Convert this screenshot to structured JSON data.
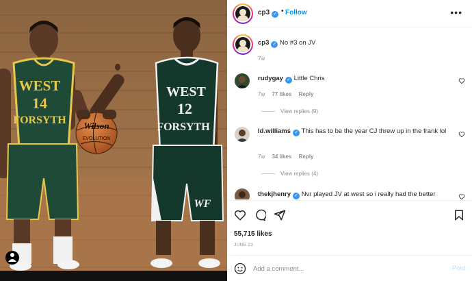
{
  "post": {
    "username": "cp3",
    "follow_label": "Follow",
    "dot": "•",
    "more_label": "•••",
    "caption": "No #3 on JV",
    "caption_age": "7w",
    "likes": "55,715 likes",
    "date": "JUNE 23",
    "comment_placeholder": "Add a comment...",
    "post_label": "Post"
  },
  "jerseys": {
    "left_team_line1": "WEST",
    "left_number": "14",
    "left_team_line2": "FORSYTH",
    "right_team_line1": "WEST",
    "right_number": "12",
    "right_team_line2": "FORSYTH",
    "shorts_logo": "WF",
    "ball_brand": "Wilson",
    "ball_model": "EVOLUTION"
  },
  "comments": [
    {
      "username": "rudygay",
      "text": "Little Chris",
      "age": "7w",
      "likes": "77 likes",
      "reply": "Reply",
      "view_replies": "View replies (9)"
    },
    {
      "username": "ld.williams",
      "text": "This has to be the year CJ threw up in the frank lol",
      "age": "7w",
      "likes": "34 likes",
      "reply": "Reply",
      "view_replies": "View replies (4)"
    },
    {
      "username": "thekjhenry",
      "text": "Nvr played JV at west so i really had the better"
    }
  ],
  "icons": [
    "heart-icon",
    "comment-icon",
    "share-icon",
    "bookmark-icon",
    "emoji-icon",
    "verified-icon",
    "more-icon"
  ],
  "colors": {
    "accent": "#0095f6",
    "verified": "#3897f0",
    "jersey_left": "#1f4a38",
    "jersey_right": "#14382c",
    "trim": "#e8c84a",
    "court": "#a8754a"
  }
}
